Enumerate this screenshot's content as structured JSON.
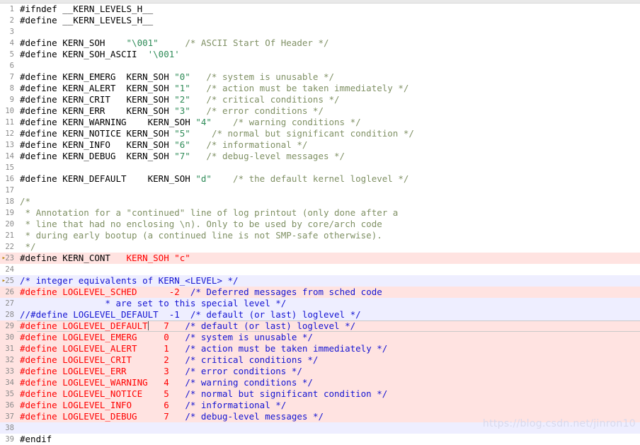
{
  "editor": {
    "language": "c",
    "watermark": "https://blog.csdn.net/jinron10",
    "colors": {
      "background": "#ffffff",
      "gutter_text": "#8a8a8a",
      "comment": "#7f9064",
      "string": "#2e8b57",
      "plain": "#000000",
      "highlight_red_text": "#ff0000",
      "highlight_blue_text": "#1414d2",
      "highlight_pink_bg": "#ffe3e1",
      "highlight_lavender_bg": "#eeeeff"
    },
    "lines": [
      {
        "n": "1",
        "bg": "white",
        "marker": false,
        "tokens": [
          {
            "t": "plain",
            "s": "#ifndef __KERN_LEVELS_H__"
          }
        ]
      },
      {
        "n": "2",
        "bg": "white",
        "marker": false,
        "tokens": [
          {
            "t": "plain",
            "s": "#define __KERN_LEVELS_H__"
          }
        ]
      },
      {
        "n": "3",
        "bg": "white",
        "marker": false,
        "tokens": [
          {
            "t": "plain",
            "s": ""
          }
        ]
      },
      {
        "n": "4",
        "bg": "white",
        "marker": false,
        "tokens": [
          {
            "t": "plain",
            "s": "#define KERN_SOH    "
          },
          {
            "t": "str",
            "s": "\"\\001\""
          },
          {
            "t": "plain",
            "s": "     "
          },
          {
            "t": "cmt",
            "s": "/* ASCII Start Of Header */"
          }
        ]
      },
      {
        "n": "5",
        "bg": "white",
        "marker": false,
        "tokens": [
          {
            "t": "plain",
            "s": "#define KERN_SOH_ASCII  "
          },
          {
            "t": "str",
            "s": "'\\001'"
          }
        ]
      },
      {
        "n": "6",
        "bg": "white",
        "marker": false,
        "tokens": [
          {
            "t": "plain",
            "s": ""
          }
        ]
      },
      {
        "n": "7",
        "bg": "white",
        "marker": false,
        "tokens": [
          {
            "t": "plain",
            "s": "#define KERN_EMERG  KERN_SOH "
          },
          {
            "t": "str",
            "s": "\"0\""
          },
          {
            "t": "plain",
            "s": "   "
          },
          {
            "t": "cmt",
            "s": "/* system is unusable */"
          }
        ]
      },
      {
        "n": "8",
        "bg": "white",
        "marker": false,
        "tokens": [
          {
            "t": "plain",
            "s": "#define KERN_ALERT  KERN_SOH "
          },
          {
            "t": "str",
            "s": "\"1\""
          },
          {
            "t": "plain",
            "s": "   "
          },
          {
            "t": "cmt",
            "s": "/* action must be taken immediately */"
          }
        ]
      },
      {
        "n": "9",
        "bg": "white",
        "marker": false,
        "tokens": [
          {
            "t": "plain",
            "s": "#define KERN_CRIT   KERN_SOH "
          },
          {
            "t": "str",
            "s": "\"2\""
          },
          {
            "t": "plain",
            "s": "   "
          },
          {
            "t": "cmt",
            "s": "/* critical conditions */"
          }
        ]
      },
      {
        "n": "10",
        "bg": "white",
        "marker": false,
        "tokens": [
          {
            "t": "plain",
            "s": "#define KERN_ERR    KERN_SOH "
          },
          {
            "t": "str",
            "s": "\"3\""
          },
          {
            "t": "plain",
            "s": "   "
          },
          {
            "t": "cmt",
            "s": "/* error conditions */"
          }
        ]
      },
      {
        "n": "11",
        "bg": "white",
        "marker": false,
        "tokens": [
          {
            "t": "plain",
            "s": "#define KERN_WARNING    KERN_SOH "
          },
          {
            "t": "str",
            "s": "\"4\""
          },
          {
            "t": "plain",
            "s": "    "
          },
          {
            "t": "cmt",
            "s": "/* warning conditions */"
          }
        ]
      },
      {
        "n": "12",
        "bg": "white",
        "marker": false,
        "tokens": [
          {
            "t": "plain",
            "s": "#define KERN_NOTICE KERN_SOH "
          },
          {
            "t": "str",
            "s": "\"5\""
          },
          {
            "t": "plain",
            "s": "    "
          },
          {
            "t": "cmt",
            "s": "/* normal but significant condition */"
          }
        ]
      },
      {
        "n": "13",
        "bg": "white",
        "marker": false,
        "tokens": [
          {
            "t": "plain",
            "s": "#define KERN_INFO   KERN_SOH "
          },
          {
            "t": "str",
            "s": "\"6\""
          },
          {
            "t": "plain",
            "s": "   "
          },
          {
            "t": "cmt",
            "s": "/* informational */"
          }
        ]
      },
      {
        "n": "14",
        "bg": "white",
        "marker": false,
        "tokens": [
          {
            "t": "plain",
            "s": "#define KERN_DEBUG  KERN_SOH "
          },
          {
            "t": "str",
            "s": "\"7\""
          },
          {
            "t": "plain",
            "s": "   "
          },
          {
            "t": "cmt",
            "s": "/* debug-level messages */"
          }
        ]
      },
      {
        "n": "15",
        "bg": "white",
        "marker": false,
        "tokens": [
          {
            "t": "plain",
            "s": ""
          }
        ]
      },
      {
        "n": "16",
        "bg": "white",
        "marker": false,
        "tokens": [
          {
            "t": "plain",
            "s": "#define KERN_DEFAULT    KERN_SOH "
          },
          {
            "t": "str",
            "s": "\"d\""
          },
          {
            "t": "plain",
            "s": "    "
          },
          {
            "t": "cmt",
            "s": "/* the default kernel loglevel */"
          }
        ]
      },
      {
        "n": "17",
        "bg": "white",
        "marker": false,
        "tokens": [
          {
            "t": "plain",
            "s": ""
          }
        ]
      },
      {
        "n": "18",
        "bg": "white",
        "marker": false,
        "tokens": [
          {
            "t": "cmt",
            "s": "/*"
          }
        ]
      },
      {
        "n": "19",
        "bg": "white",
        "marker": false,
        "tokens": [
          {
            "t": "cmt",
            "s": " * Annotation for a \"continued\" line of log printout (only done after a"
          }
        ]
      },
      {
        "n": "20",
        "bg": "white",
        "marker": false,
        "tokens": [
          {
            "t": "cmt",
            "s": " * line that had no enclosing \\n). Only to be used by core/arch code"
          }
        ]
      },
      {
        "n": "21",
        "bg": "white",
        "marker": false,
        "tokens": [
          {
            "t": "cmt",
            "s": " * during early bootup (a continued line is not SMP-safe otherwise)."
          }
        ]
      },
      {
        "n": "22",
        "bg": "white",
        "marker": false,
        "tokens": [
          {
            "t": "cmt",
            "s": " */"
          }
        ]
      },
      {
        "n": "23",
        "bg": "pink",
        "marker": true,
        "tokens": [
          {
            "t": "plain",
            "s": "#define KERN_CONT   "
          },
          {
            "t": "red",
            "s": "KERN_SOH \"c\""
          }
        ]
      },
      {
        "n": "24",
        "bg": "white",
        "marker": false,
        "tokens": [
          {
            "t": "plain",
            "s": ""
          }
        ]
      },
      {
        "n": "25",
        "bg": "lav",
        "marker": true,
        "tokens": [
          {
            "t": "blue",
            "s": "/* integer equivalents of KERN_<LEVEL> */"
          }
        ]
      },
      {
        "n": "26",
        "bg": "pink",
        "marker": false,
        "tokens": [
          {
            "t": "red",
            "s": "#define LOGLEVEL_SCHED"
          },
          {
            "t": "plain",
            "s": "      "
          },
          {
            "t": "red",
            "s": "-2"
          },
          {
            "t": "plain",
            "s": "  "
          },
          {
            "t": "blue",
            "s": "/* Deferred messages from sched code"
          }
        ]
      },
      {
        "n": "27",
        "bg": "lav",
        "marker": false,
        "tokens": [
          {
            "t": "plain",
            "s": "                "
          },
          {
            "t": "blue",
            "s": "* are set to this special level */"
          }
        ]
      },
      {
        "n": "28",
        "bg": "lav",
        "marker": false,
        "tokens": [
          {
            "t": "blue",
            "s": "//#define LOGLEVEL_DEFAULT  -1  /* default (or last) loglevel */"
          }
        ]
      },
      {
        "n": "29",
        "bg": "cur",
        "marker": false,
        "cursor_after": 1,
        "tokens": [
          {
            "t": "red",
            "s": "#define LOGLEVEL_DEFAULT"
          },
          {
            "t": "plain",
            "s": "   "
          },
          {
            "t": "red",
            "s": "7"
          },
          {
            "t": "plain",
            "s": "   "
          },
          {
            "t": "blue",
            "s": "/* default (or last) loglevel */"
          }
        ]
      },
      {
        "n": "30",
        "bg": "pink",
        "marker": false,
        "tokens": [
          {
            "t": "red",
            "s": "#define LOGLEVEL_EMERG"
          },
          {
            "t": "plain",
            "s": "     "
          },
          {
            "t": "red",
            "s": "0"
          },
          {
            "t": "plain",
            "s": "   "
          },
          {
            "t": "blue",
            "s": "/* system is unusable */"
          }
        ]
      },
      {
        "n": "31",
        "bg": "pink",
        "marker": false,
        "tokens": [
          {
            "t": "red",
            "s": "#define LOGLEVEL_ALERT"
          },
          {
            "t": "plain",
            "s": "     "
          },
          {
            "t": "red",
            "s": "1"
          },
          {
            "t": "plain",
            "s": "   "
          },
          {
            "t": "blue",
            "s": "/* action must be taken immediately */"
          }
        ]
      },
      {
        "n": "32",
        "bg": "pink",
        "marker": false,
        "tokens": [
          {
            "t": "red",
            "s": "#define LOGLEVEL_CRIT"
          },
          {
            "t": "plain",
            "s": "      "
          },
          {
            "t": "red",
            "s": "2"
          },
          {
            "t": "plain",
            "s": "   "
          },
          {
            "t": "blue",
            "s": "/* critical conditions */"
          }
        ]
      },
      {
        "n": "33",
        "bg": "pink",
        "marker": false,
        "tokens": [
          {
            "t": "red",
            "s": "#define LOGLEVEL_ERR"
          },
          {
            "t": "plain",
            "s": "       "
          },
          {
            "t": "red",
            "s": "3"
          },
          {
            "t": "plain",
            "s": "   "
          },
          {
            "t": "blue",
            "s": "/* error conditions */"
          }
        ]
      },
      {
        "n": "34",
        "bg": "pink",
        "marker": false,
        "tokens": [
          {
            "t": "red",
            "s": "#define LOGLEVEL_WARNING"
          },
          {
            "t": "plain",
            "s": "   "
          },
          {
            "t": "red",
            "s": "4"
          },
          {
            "t": "plain",
            "s": "   "
          },
          {
            "t": "blue",
            "s": "/* warning conditions */"
          }
        ]
      },
      {
        "n": "35",
        "bg": "pink",
        "marker": false,
        "tokens": [
          {
            "t": "red",
            "s": "#define LOGLEVEL_NOTICE"
          },
          {
            "t": "plain",
            "s": "    "
          },
          {
            "t": "red",
            "s": "5"
          },
          {
            "t": "plain",
            "s": "   "
          },
          {
            "t": "blue",
            "s": "/* normal but significant condition */"
          }
        ]
      },
      {
        "n": "36",
        "bg": "pink",
        "marker": false,
        "tokens": [
          {
            "t": "red",
            "s": "#define LOGLEVEL_INFO"
          },
          {
            "t": "plain",
            "s": "      "
          },
          {
            "t": "red",
            "s": "6"
          },
          {
            "t": "plain",
            "s": "   "
          },
          {
            "t": "blue",
            "s": "/* informational */"
          }
        ]
      },
      {
        "n": "37",
        "bg": "pink",
        "marker": false,
        "tokens": [
          {
            "t": "red",
            "s": "#define LOGLEVEL_DEBUG"
          },
          {
            "t": "plain",
            "s": "     "
          },
          {
            "t": "red",
            "s": "7"
          },
          {
            "t": "plain",
            "s": "   "
          },
          {
            "t": "blue",
            "s": "/* debug-level messages */"
          }
        ]
      },
      {
        "n": "38",
        "bg": "lav",
        "marker": false,
        "tokens": [
          {
            "t": "plain",
            "s": ""
          }
        ]
      },
      {
        "n": "39",
        "bg": "white",
        "marker": false,
        "tokens": [
          {
            "t": "plain",
            "s": "#endif"
          }
        ]
      }
    ]
  }
}
